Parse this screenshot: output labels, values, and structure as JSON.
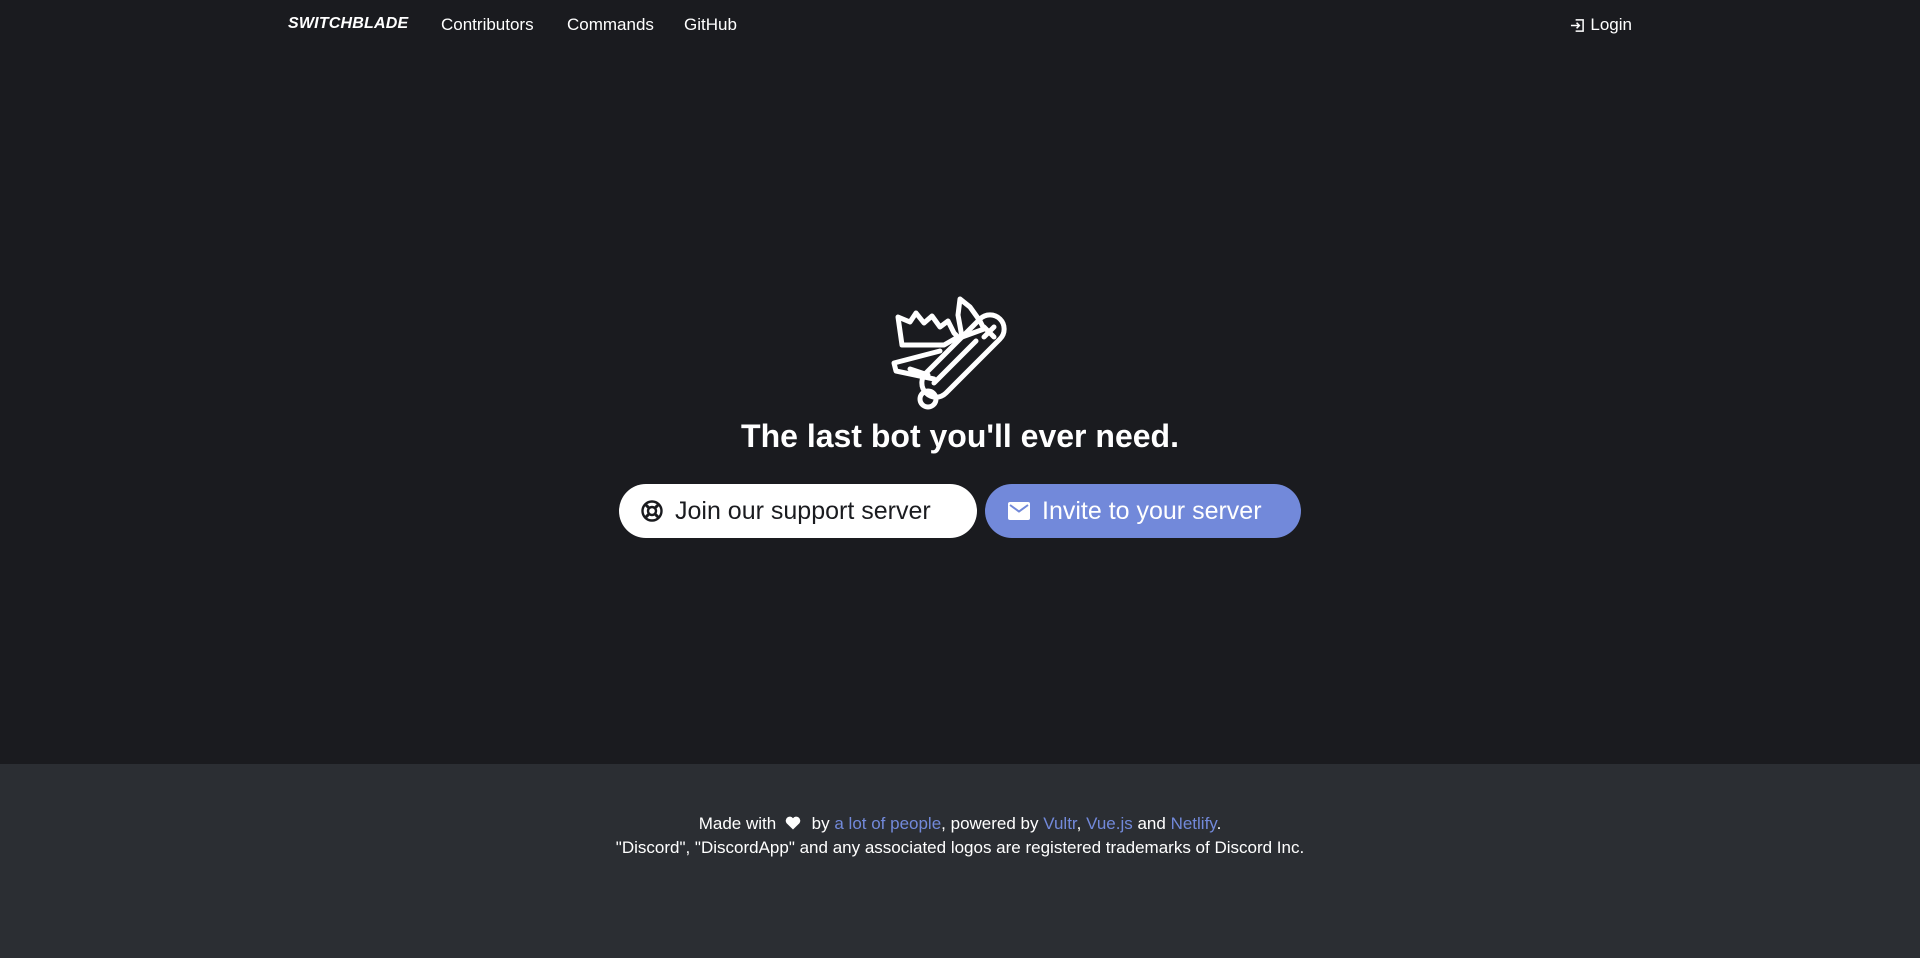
{
  "nav": {
    "brand": "SWITCHBLADE",
    "links": [
      "Contributors",
      "Commands",
      "GitHub"
    ],
    "login": "Login"
  },
  "hero": {
    "logo_icon": "swiss-army-knife-icon",
    "tagline": "The last bot you'll ever need.",
    "support_button": "Join our support server",
    "support_icon": "lifebuoy-icon",
    "invite_button": "Invite to your server",
    "invite_icon": "envelope-icon"
  },
  "footer": {
    "made_with": "Made with",
    "heart_icon": "heart-icon",
    "by": "by",
    "people_link": "a lot of people",
    "powered_by": ", powered by",
    "vultr": "Vultr",
    "comma": ",",
    "vuejs": "Vue.js",
    "and": "and",
    "netlify": "Netlify",
    "period": ".",
    "trademark": "\"Discord\", \"DiscordApp\" and any associated logos are registered trademarks of Discord Inc."
  },
  "colors": {
    "background": "#1a1b1f",
    "footer_background": "#2b2e33",
    "accent": "#7289da",
    "text": "#ffffff"
  }
}
